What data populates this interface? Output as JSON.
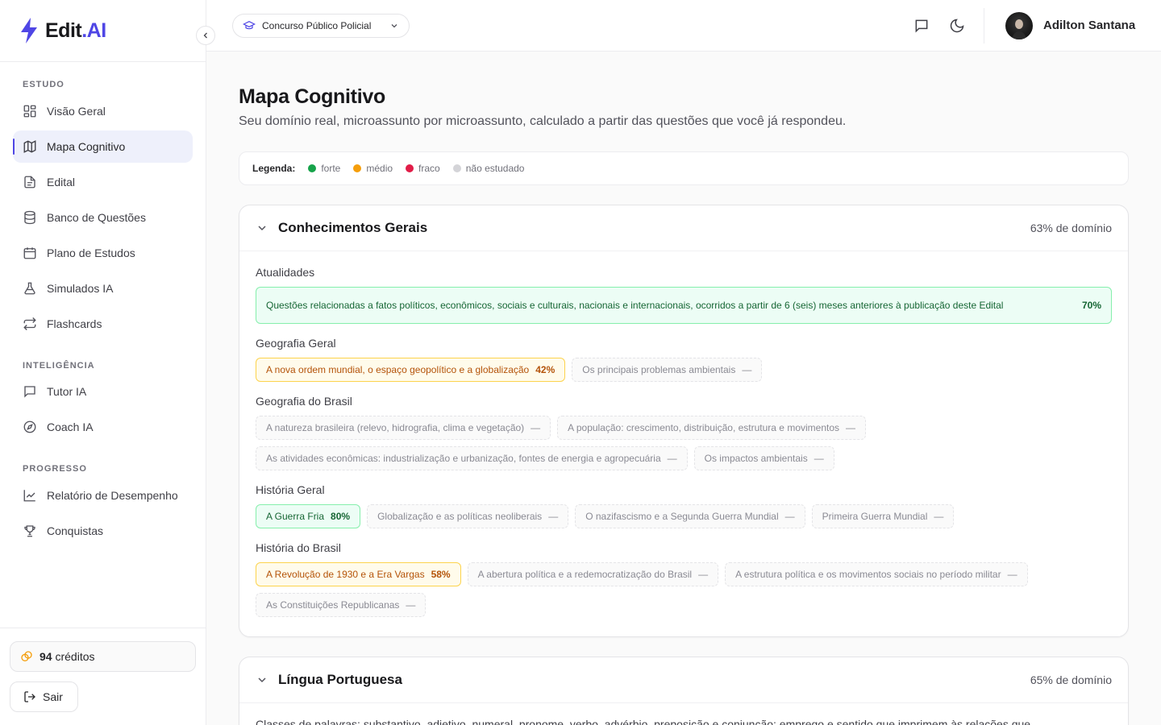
{
  "brand": {
    "name": "Edit",
    "suffix": ".AI"
  },
  "sidebar": {
    "sections": [
      {
        "label": "ESTUDO"
      },
      {
        "label": "INTELIGÊNCIA"
      },
      {
        "label": "PROGRESSO"
      }
    ],
    "items": [
      {
        "label": "Visão Geral",
        "icon": "layout-grid-icon"
      },
      {
        "label": "Mapa Cognitivo",
        "icon": "map-icon",
        "active": true
      },
      {
        "label": "Edital",
        "icon": "document-icon"
      },
      {
        "label": "Banco de Questões",
        "icon": "database-icon"
      },
      {
        "label": "Plano de Estudos",
        "icon": "calendar-icon"
      },
      {
        "label": "Simulados IA",
        "icon": "flask-icon"
      },
      {
        "label": "Flashcards",
        "icon": "repeat-icon"
      },
      {
        "label": "Tutor IA",
        "icon": "message-icon"
      },
      {
        "label": "Coach IA",
        "icon": "compass-icon"
      },
      {
        "label": "Relatório de Desempenho",
        "icon": "chart-line-icon"
      },
      {
        "label": "Conquistas",
        "icon": "trophy-icon"
      }
    ],
    "credits": {
      "value": "94",
      "label": "créditos"
    },
    "logout_label": "Sair"
  },
  "header": {
    "course": "Concurso Público Policial",
    "user_name": "Adilton Santana"
  },
  "page": {
    "title": "Mapa Cognitivo",
    "subtitle": "Seu domínio real, microassunto por microassunto, calculado a partir das questões que você já respondeu."
  },
  "legend": {
    "label": "Legenda:",
    "items": [
      {
        "label": "forte",
        "color": "#16a34a"
      },
      {
        "label": "médio",
        "color": "#f59e0b"
      },
      {
        "label": "fraco",
        "color": "#e11d48"
      },
      {
        "label": "não estudado",
        "color": "#d4d4d8"
      }
    ]
  },
  "subjects": [
    {
      "title": "Conhecimentos Gerais",
      "domain": "63% de domínio",
      "topics": [
        {
          "name": "Atualidades",
          "items": [
            {
              "text": "Questões relacionadas a fatos políticos, econômicos, sociais e culturais, nacionais e internacionais, ocorridos a partir de 6 (seis) meses anteriores à publicação deste Edital",
              "value": "70%",
              "level": "strong"
            }
          ]
        },
        {
          "name": "Geografia Geral",
          "items": [
            {
              "text": "A nova ordem mundial, o espaço geopolítico e a globalização",
              "value": "42%",
              "level": "medium"
            },
            {
              "text": "Os principais problemas ambientais",
              "value": "—",
              "level": "none"
            }
          ]
        },
        {
          "name": "Geografia do Brasil",
          "items": [
            {
              "text": "A natureza brasileira (relevo, hidrografia, clima e vegetação)",
              "value": "—",
              "level": "none"
            },
            {
              "text": "A população: crescimento, distribuição, estrutura e movimentos",
              "value": "—",
              "level": "none"
            },
            {
              "text": "As atividades econômicas: industrialização e urbanização, fontes de energia e agropecuária",
              "value": "—",
              "level": "none"
            },
            {
              "text": "Os impactos ambientais",
              "value": "—",
              "level": "none"
            }
          ]
        },
        {
          "name": "História Geral",
          "items": [
            {
              "text": "A Guerra Fria",
              "value": "80%",
              "level": "strong"
            },
            {
              "text": "Globalização e as políticas neoliberais",
              "value": "—",
              "level": "none"
            },
            {
              "text": "O nazifascismo e a Segunda Guerra Mundial",
              "value": "—",
              "level": "none"
            },
            {
              "text": "Primeira Guerra Mundial",
              "value": "—",
              "level": "none"
            }
          ]
        },
        {
          "name": "História do Brasil",
          "items": [
            {
              "text": "A Revolução de 1930 e a Era Vargas",
              "value": "58%",
              "level": "medium"
            },
            {
              "text": "A abertura política e a redemocratização do Brasil",
              "value": "—",
              "level": "none"
            },
            {
              "text": "A estrutura política e os movimentos sociais no período militar",
              "value": "—",
              "level": "none"
            },
            {
              "text": "As Constituições Republicanas",
              "value": "—",
              "level": "none"
            }
          ]
        }
      ]
    },
    {
      "title": "Língua Portuguesa",
      "domain": "65% de domínio",
      "first_topic": "Classes de palavras: substantivo, adjetivo, numeral, pronome, verbo, advérbio, preposição e conjunção: emprego e sentido que imprimem às relações que"
    }
  ]
}
